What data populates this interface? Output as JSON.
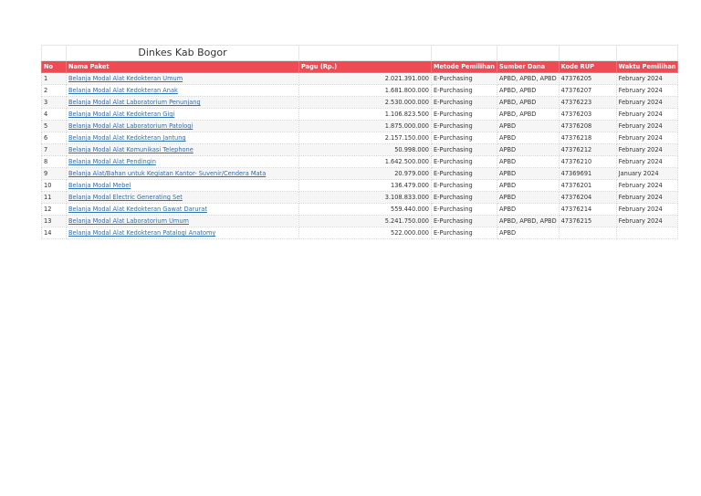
{
  "title": "Dinkes  Kab Bogor",
  "headers": [
    "No",
    "Nama Paket",
    "Pagu (Rp.)",
    "Metode Pemilihan",
    "Sumber Dana",
    "Kode RUP",
    "Waktu Pemilihan"
  ],
  "rows": [
    [
      "1",
      "Belanja Modal Alat Kedokteran Umum",
      "2.021.391.000",
      "E-Purchasing",
      "APBD, APBD, APBD",
      "47376205",
      "February 2024"
    ],
    [
      "2",
      "Belanja Modal Alat Kedokteran Anak",
      "1.681.800.000",
      "E-Purchasing",
      "APBD, APBD",
      "47376207",
      "February 2024"
    ],
    [
      "3",
      "Belanja Modal Alat Laboratorium Penunjang",
      "2.530.000.000",
      "E-Purchasing",
      "APBD, APBD",
      "47376223",
      "February 2024"
    ],
    [
      "4",
      "Belanja Modal Alat Kedokteran Gigi",
      "1.106.823.500",
      "E-Purchasing",
      "APBD, APBD",
      "47376203",
      "February 2024"
    ],
    [
      "5",
      "Belanja Modal Alat Laboratorium Patologi",
      "1.875.000.000",
      "E-Purchasing",
      "APBD",
      "47376208",
      "February 2024"
    ],
    [
      "6",
      "Belanja Modal Alat Kedokteran Jantung",
      "2.157.150.000",
      "E-Purchasing",
      "APBD",
      "47376218",
      "February 2024"
    ],
    [
      "7",
      "Belanja Modal Alat Komunikasi Telephone",
      "50.998.000",
      "E-Purchasing",
      "APBD",
      "47376212",
      "February 2024"
    ],
    [
      "8",
      "Belanja Modal Alat Pendingin",
      "1.642.500.000",
      "E-Purchasing",
      "APBD",
      "47376210",
      "February 2024"
    ],
    [
      "9",
      "Belanja Alat/Bahan untuk Kegiatan Kantor- Suvenir/Cendera Mata",
      "20.979.000",
      "E-Purchasing",
      "APBD",
      "47369691",
      "January 2024"
    ],
    [
      "10",
      "Belanja Modal Mebel",
      "136.479.000",
      "E-Purchasing",
      "APBD",
      "47376201",
      "February 2024"
    ],
    [
      "11",
      "Belanja Modal Electric Generating Set",
      "3.108.833.000",
      "E-Purchasing",
      "APBD",
      "47376204",
      "February 2024"
    ],
    [
      "12",
      "Belanja Modal Alat Kedokteran Gawat Darurat",
      "559.440.000",
      "E-Purchasing",
      "APBD",
      "47376214",
      "February 2024"
    ],
    [
      "13",
      "Belanja Modal Alat Laboratorium Umum",
      "5.241.750.000",
      "E-Purchasing",
      "APBD, APBD, APBD",
      "47376215",
      "February 2024"
    ],
    [
      "14",
      "Belanja Modal Alat Kedokteran Patalogi Anatomy",
      "522.000.000",
      "E-Purchasing",
      "APBD",
      "",
      ""
    ]
  ]
}
